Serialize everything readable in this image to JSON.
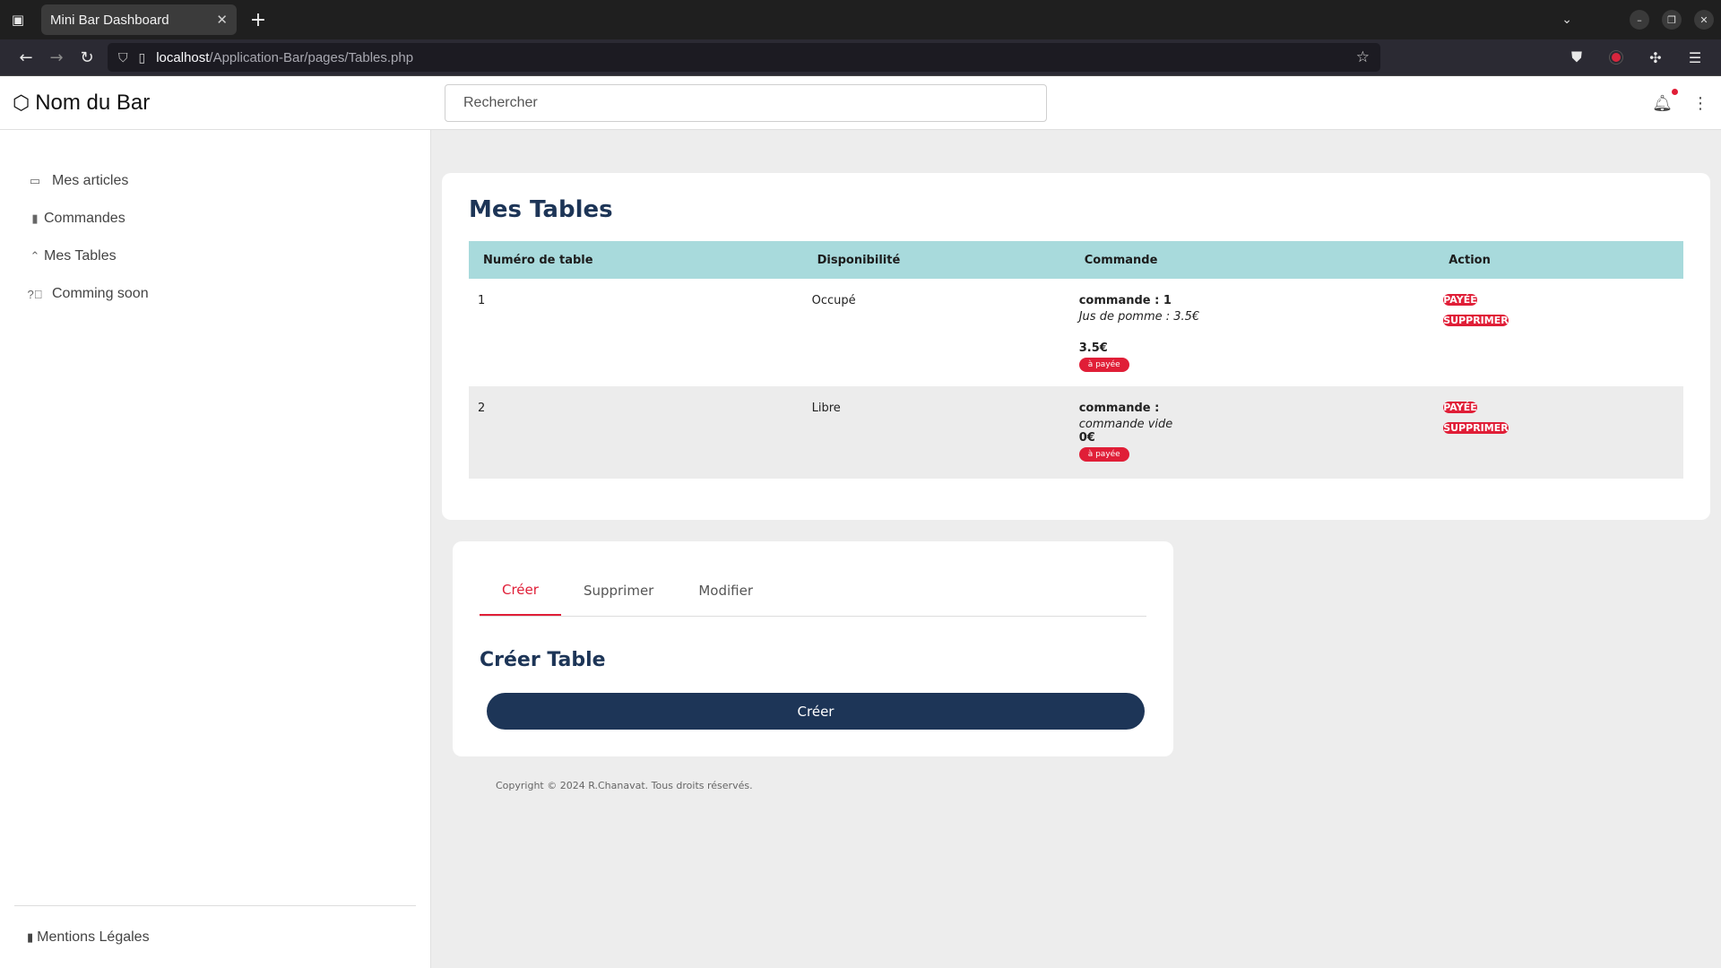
{
  "browser": {
    "tab_title": "Mini Bar Dashboard",
    "url_host": "localhost",
    "url_path": "/Application-Bar/pages/Tables.php"
  },
  "header": {
    "brand": "Nom du Bar",
    "search_placeholder": "Rechercher"
  },
  "sidebar": {
    "items": [
      {
        "label": "Mes articles",
        "icon": "calendar-icon"
      },
      {
        "label": "Commandes",
        "icon": "clipboard-icon"
      },
      {
        "label": "Mes Tables",
        "icon": "chevrons-up-icon"
      },
      {
        "label": "Comming soon",
        "icon": "question-icon"
      }
    ],
    "footer": "Mentions Légales"
  },
  "tables_card": {
    "title": "Mes Tables",
    "columns": [
      "Numéro de table",
      "Disponibilité",
      "Commande",
      "Action"
    ],
    "rows": [
      {
        "number": "1",
        "availability": "Occupé",
        "order_title": "commande : 1",
        "order_items": "Jus de pomme : 3.5€",
        "total": "3.5€",
        "status": "à payée",
        "action_pay": "PAYÉE",
        "action_delete": "SUPPRIMER"
      },
      {
        "number": "2",
        "availability": "Libre",
        "order_title": "commande :",
        "order_items": "commande vide",
        "total": "0€",
        "status": "à payée",
        "action_pay": "PAYÉE",
        "action_delete": "SUPPRIMER"
      }
    ]
  },
  "form_card": {
    "tabs": [
      "Créer",
      "Supprimer",
      "Modifier"
    ],
    "active_tab": "Créer",
    "title": "Créer Table",
    "button": "Créer"
  },
  "footer": {
    "copyright": "Copyright © 2024 R.Chanavat. Tous droits réservés."
  },
  "colors": {
    "accent": "#e01e37",
    "primary": "#1d3557",
    "table_header": "#a8dadc"
  }
}
